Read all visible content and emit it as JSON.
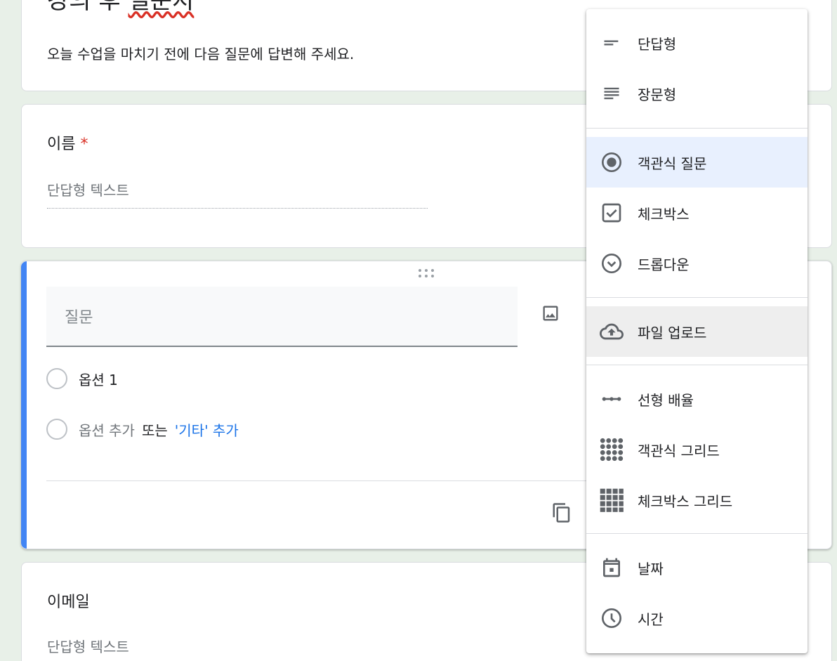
{
  "form": {
    "title_prefix": "강의 후 ",
    "title_underlined": "설문지",
    "description": "오늘 수업을 마치기 전에 다음 질문에 답변해 주세요."
  },
  "name_question": {
    "title": "이름",
    "required_mark": "*",
    "answer_placeholder": "단답형 텍스트"
  },
  "active_question": {
    "question_placeholder": "질문",
    "option1": "옵션 1",
    "add_option": "옵션 추가",
    "or": "또는",
    "add_other": "'기타' 추가"
  },
  "email_question": {
    "title": "이메일",
    "answer_placeholder": "단답형 텍스트"
  },
  "type_menu": {
    "items": [
      {
        "label": "단답형",
        "icon": "short-answer-icon"
      },
      {
        "label": "장문형",
        "icon": "paragraph-icon"
      },
      {
        "label": "객관식 질문",
        "icon": "radio-button-icon",
        "selected": true
      },
      {
        "label": "체크박스",
        "icon": "checkbox-icon"
      },
      {
        "label": "드롭다운",
        "icon": "dropdown-icon"
      },
      {
        "label": "파일 업로드",
        "icon": "cloud-upload-icon",
        "hover": true
      },
      {
        "label": "선형 배율",
        "icon": "linear-scale-icon"
      },
      {
        "label": "객관식 그리드",
        "icon": "dot-grid-icon"
      },
      {
        "label": "체크박스 그리드",
        "icon": "square-grid-icon"
      },
      {
        "label": "날짜",
        "icon": "calendar-icon"
      },
      {
        "label": "시간",
        "icon": "clock-icon"
      }
    ]
  },
  "colors": {
    "accent": "#4285f4",
    "required": "#d93025",
    "link": "#1a73e8",
    "menu_selected": "#e8f0fe",
    "menu_hover": "#eeeeee",
    "icon": "#5f6368"
  }
}
